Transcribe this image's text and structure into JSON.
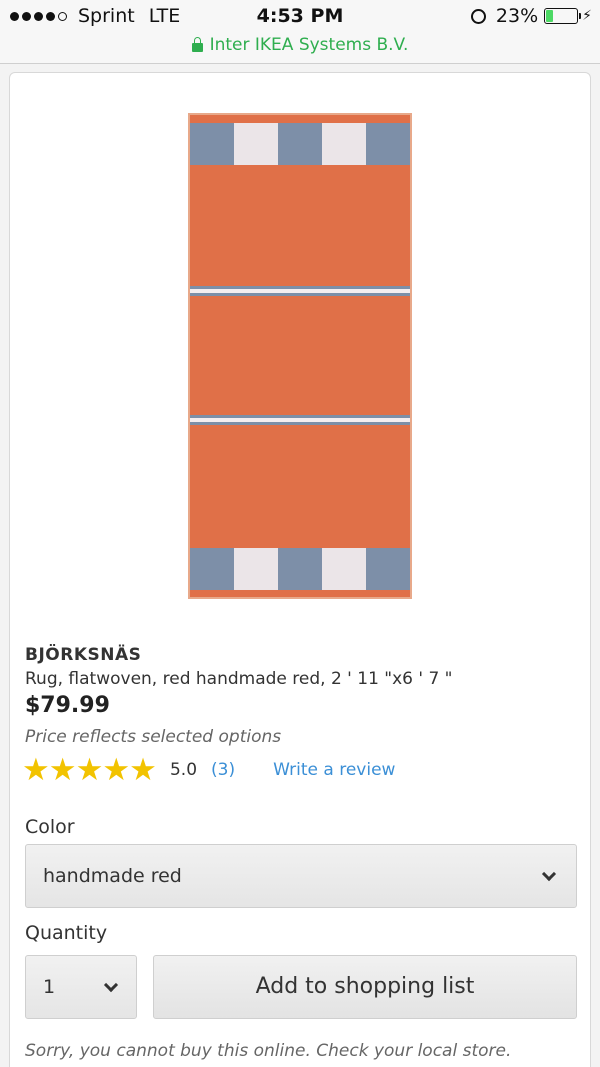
{
  "status_bar": {
    "carrier": "Sprint",
    "network": "LTE",
    "time": "4:53 PM",
    "battery": "23%",
    "battery_level": 0.23
  },
  "url_bar": {
    "site": "Inter IKEA Systems B.V."
  },
  "product": {
    "name": "BJÖRKSNÄS",
    "description": "Rug, flatwoven, red handmade red, 2 ' 11 \"x6 ' 7 \"",
    "price": "$79.99",
    "price_note": "Price reflects selected options",
    "rating_stars": "★★★★★",
    "rating_value": "5.0",
    "rating_count": "(3)",
    "write_review": "Write a review",
    "image_colors": {
      "rug": "#e07048",
      "stripe_blue": "#7d8fa8",
      "stripe_white": "#ebe5e8"
    }
  },
  "options": {
    "color_label": "Color",
    "color_value": "handmade red",
    "quantity_label": "Quantity",
    "quantity_value": "1"
  },
  "actions": {
    "add_to_list": "Add to shopping list",
    "unavailable_note": "Sorry, you cannot buy this online. Check your local store."
  },
  "colors": {
    "link": "#3b8fd6",
    "secure": "#2fae4f",
    "star": "#f2c300"
  }
}
